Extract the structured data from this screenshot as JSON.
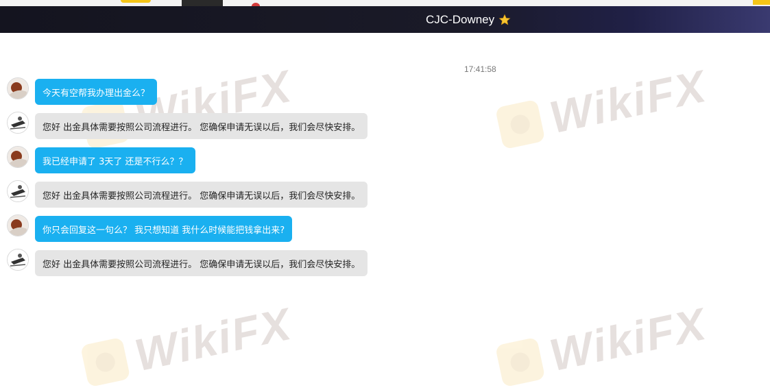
{
  "header": {
    "title": "CJC-Downey",
    "star_icon": "star-icon"
  },
  "watermark": {
    "text": "WikiFX",
    "logo_color": "#f2c14e"
  },
  "colors": {
    "user_bubble": "#1ab0f0",
    "agent_bubble": "#e5e5e5",
    "header_bg": "#14141f"
  },
  "chat": {
    "timestamp": "17:41:58",
    "messages": [
      {
        "sender": "user",
        "text": "今天有空帮我办理出金么？"
      },
      {
        "sender": "agent",
        "text": "您好 出金具体需要按照公司流程进行。 您确保申请无误以后，我们会尽快安排。"
      },
      {
        "sender": "user",
        "text": "我已经申请了 3天了 还是不行么？？"
      },
      {
        "sender": "agent",
        "text": "您好 出金具体需要按照公司流程进行。 您确保申请无误以后，我们会尽快安排。"
      },
      {
        "sender": "user",
        "text": "你只会回复这一句么？ 我只想知道 我什么时候能把钱拿出来?"
      },
      {
        "sender": "agent",
        "text": "您好 出金具体需要按照公司流程进行。 您确保申请无误以后，我们会尽快安排。"
      }
    ]
  }
}
